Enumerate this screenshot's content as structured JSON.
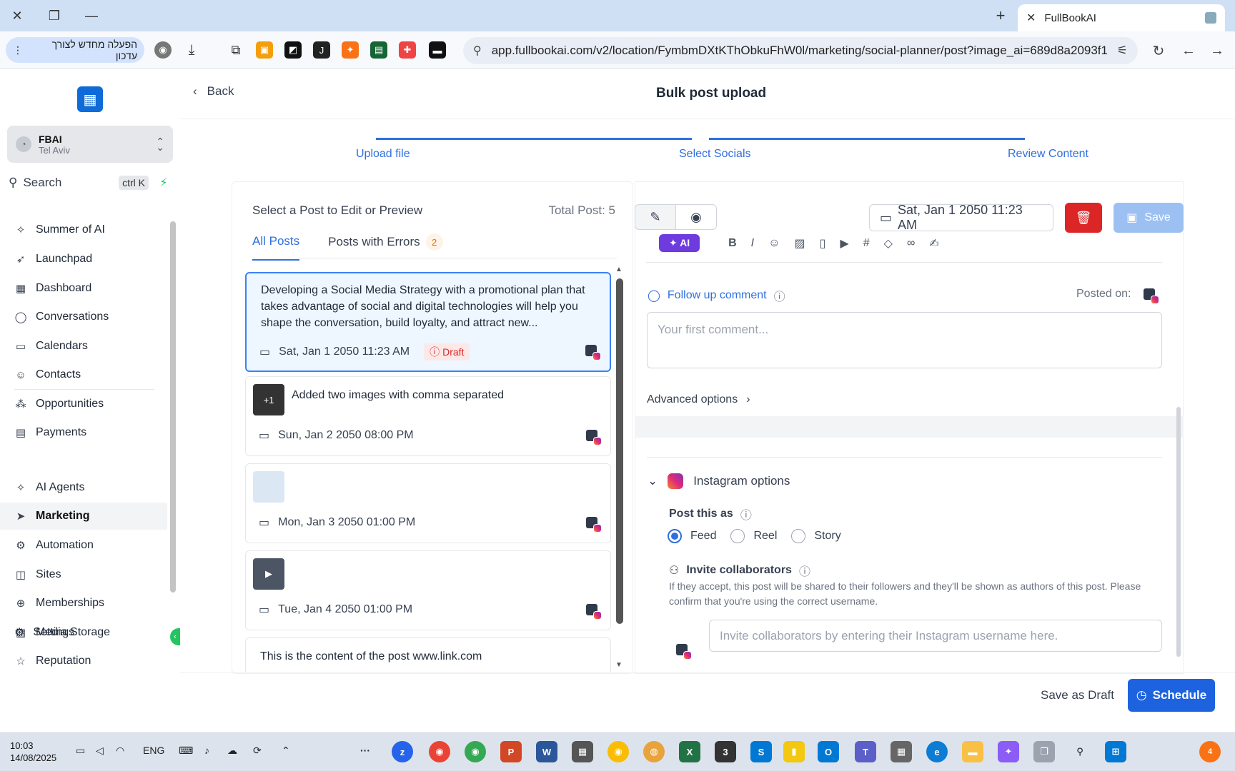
{
  "browser": {
    "tab_title": "FullBookAI",
    "update_pill": "הפעלה מחדש לצורך עדכון",
    "url": "app.fullbookai.com/v2/location/FymbmDXtKThObkuFhW0l/marketing/social-planner/post?image_ai=689d8a2093f12..."
  },
  "account": {
    "name": "FBAI",
    "location": "Tel Aviv"
  },
  "search": {
    "label": "Search",
    "shortcut": "ctrl K"
  },
  "nav": {
    "items": [
      {
        "label": "Summer of AI",
        "icon": "sparkle-icon"
      },
      {
        "label": "Launchpad",
        "icon": "rocket-icon"
      },
      {
        "label": "Dashboard",
        "icon": "dashboard-icon"
      },
      {
        "label": "Conversations",
        "icon": "chat-icon"
      },
      {
        "label": "Calendars",
        "icon": "calendar-icon"
      },
      {
        "label": "Contacts",
        "icon": "contacts-icon"
      },
      {
        "label": "Opportunities",
        "icon": "opportunities-icon"
      },
      {
        "label": "Payments",
        "icon": "payments-icon"
      },
      {
        "label": "AI Agents",
        "icon": "ai-agents-icon"
      },
      {
        "label": "Marketing",
        "icon": "send-icon"
      },
      {
        "label": "Automation",
        "icon": "automation-icon"
      },
      {
        "label": "Sites",
        "icon": "sites-icon"
      },
      {
        "label": "Memberships",
        "icon": "memberships-icon"
      },
      {
        "label": "Media Storage",
        "icon": "media-icon"
      },
      {
        "label": "Reputation",
        "icon": "star-icon"
      }
    ],
    "active": "Marketing",
    "settings": "Settings"
  },
  "header": {
    "back": "Back",
    "title": "Bulk post upload"
  },
  "steps": [
    "Upload file",
    "Select Socials",
    "Review Content"
  ],
  "list": {
    "title": "Select a Post to Edit or Preview",
    "total": "Total Post: 5",
    "tabs": [
      {
        "label": "All Posts"
      },
      {
        "label": "Posts with Errors",
        "badge": "2"
      }
    ],
    "posts": [
      {
        "text": "Developing a Social Media Strategy with a promotional plan that takes advantage of social and digital technologies will help you shape the conversation, build loyalty, and attract new...",
        "date": "Sat, Jan 1 2050 11:23 AM",
        "status": "Draft"
      },
      {
        "text": "Added two images with comma separated",
        "date": "Sun, Jan 2 2050 08:00 PM",
        "thumb": "+1"
      },
      {
        "text": "",
        "date": "Mon, Jan 3 2050 01:00 PM"
      },
      {
        "text": "",
        "date": "Tue, Jan 4 2050 01:00 PM"
      },
      {
        "text": "This is the content of the post www.link.com",
        "date": ""
      }
    ]
  },
  "editor": {
    "date": "Sat, Jan 1 2050 11:23 AM",
    "save": "Save",
    "ai": "AI",
    "follow_up": "Follow up comment",
    "posted_on": "Posted on:",
    "comment_placeholder": "Your first comment...",
    "advanced": "Advanced options",
    "instagram_options": "Instagram options",
    "post_as": "Post this as",
    "post_types": [
      "Feed",
      "Reel",
      "Story"
    ],
    "selected_post_type": "Feed",
    "invite_title": "Invite collaborators",
    "invite_desc": "If they accept, this post will be shared to their followers and they'll be shown as authors of this post. Please confirm that you're using the correct username.",
    "invite_placeholder": "Invite collaborators by entering their Instagram username here."
  },
  "footer": {
    "save_draft": "Save as Draft",
    "schedule": "Schedule"
  },
  "taskbar": {
    "time": "10:03",
    "date": "14/08/2025",
    "lang": "ENG",
    "notifications": "4"
  }
}
